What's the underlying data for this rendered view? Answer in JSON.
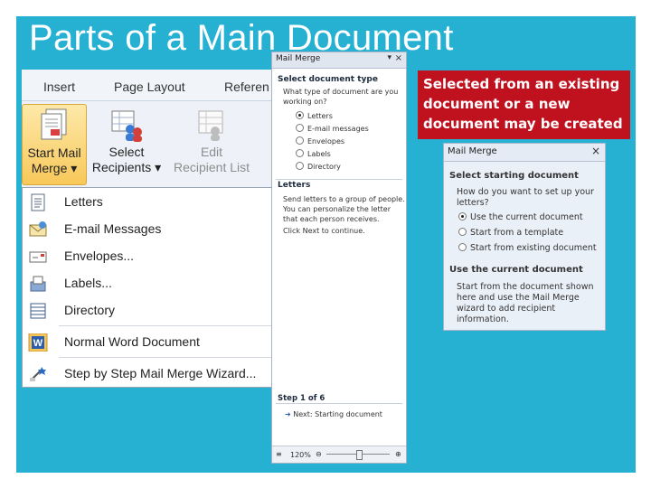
{
  "slide": {
    "title": "Parts of a Main Document"
  },
  "ribbon": {
    "tabs": [
      "Insert",
      "Page Layout",
      "Referen"
    ],
    "buttons": [
      {
        "line1": "Start Mail",
        "line2": "Merge ▾"
      },
      {
        "line1": "Select",
        "line2": "Recipients ▾"
      },
      {
        "line1": "Edit",
        "line2": "Recipient List"
      }
    ]
  },
  "menu": {
    "items": [
      {
        "label": "Letters",
        "icon": "letter-icon"
      },
      {
        "label": "E-mail Messages",
        "icon": "email-icon"
      },
      {
        "label": "Envelopes...",
        "icon": "envelope-icon"
      },
      {
        "label": "Labels...",
        "icon": "labels-icon"
      },
      {
        "label": "Directory",
        "icon": "directory-icon"
      },
      {
        "label": "Normal Word Document",
        "icon": "word-icon"
      },
      {
        "label": "Step by Step Mail Merge Wizard...",
        "icon": "wizard-icon"
      }
    ]
  },
  "pane1": {
    "title": "Mail Merge",
    "control": "▾",
    "close": "×",
    "section1": "Select document type",
    "question": [
      "What type of document are you",
      "working on?"
    ],
    "options": [
      {
        "label": "Letters",
        "selected": true
      },
      {
        "label": "E-mail messages",
        "selected": false
      },
      {
        "label": "Envelopes",
        "selected": false
      },
      {
        "label": "Labels",
        "selected": false
      },
      {
        "label": "Directory",
        "selected": false
      }
    ],
    "section2": "Letters",
    "description": [
      "Send letters to a group of people.",
      "You can personalize the letter",
      "that each person receives."
    ],
    "instruction": "Click Next to continue.",
    "step": "Step 1 of 6",
    "next_link": "Next: Starting document",
    "zoom": "120%"
  },
  "pane2": {
    "title": "Mail Merge",
    "close": "×",
    "section1": "Select starting document",
    "question": [
      "How do you want to set up your",
      "letters?"
    ],
    "options": [
      {
        "label": "Use the current document",
        "selected": true
      },
      {
        "label": "Start from a template",
        "selected": false
      },
      {
        "label": "Start from existing document",
        "selected": false
      }
    ],
    "section2": "Use the current document",
    "description": [
      "Start from the document shown",
      "here and use the Mail Merge",
      "wizard to add recipient",
      "information."
    ]
  },
  "callout": {
    "lines": [
      "Selected from an existing",
      "document or a new",
      "document may be created"
    ]
  },
  "colors": {
    "slide_bg": "#26b1d3",
    "callout_bg": "#c0111f",
    "ribbon_active": "#f8c85a"
  }
}
